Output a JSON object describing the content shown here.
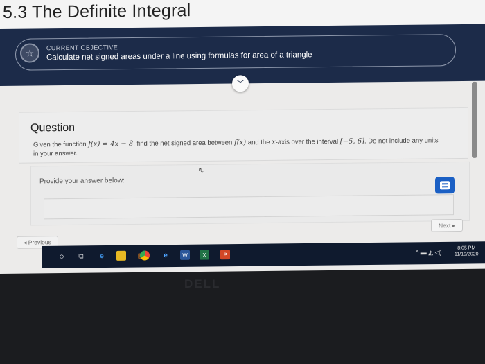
{
  "page": {
    "title": "5.3 The Definite Integral"
  },
  "objective": {
    "label": "CURRENT OBJECTIVE",
    "text": "Calculate net signed areas under a line using formulas for area of a triangle",
    "icon": "star-icon"
  },
  "question": {
    "heading": "Question",
    "text_part1": "Given the function ",
    "func": "f(x) = 4x − 8",
    "text_part2": ", find the net signed area between ",
    "func_short": "f(x)",
    "text_part3": " and the ",
    "axis_var": "x",
    "text_part4": "-axis over the interval ",
    "interval": "[−5, 6]",
    "text_part5": ". Do not include any units in your answer."
  },
  "answer": {
    "prompt": "Provide your answer below:",
    "value": ""
  },
  "navigation": {
    "previous_label": "◂ Previous",
    "next_label": "Next ▸"
  },
  "taskbar": {
    "time": "8:05 PM",
    "date": "11/19/2020",
    "tray_icons": "^ ▬ ◭ ◁)"
  },
  "bezel": {
    "logo": "DELL"
  },
  "colors": {
    "header_band": "#1c2b49",
    "notes_button": "#1a5fc4",
    "taskbar": "#0f1a2e"
  }
}
